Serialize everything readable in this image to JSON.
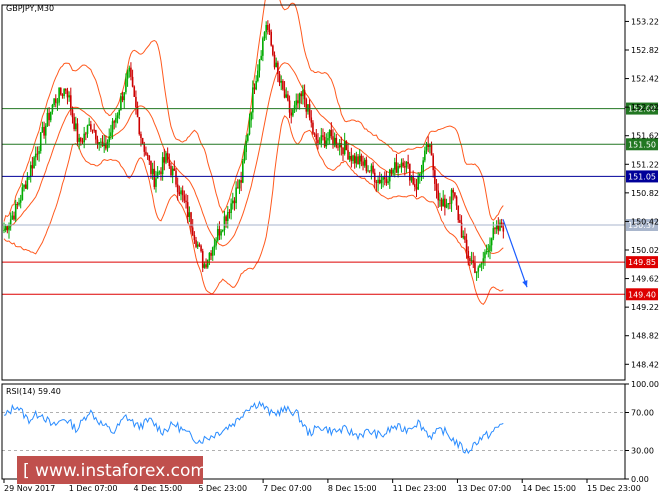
{
  "header": {
    "symbol_label": "GBPJPY,M30",
    "rsi_label": "RSI(14) 59.40"
  },
  "watermark": {
    "text": "[ www.instaforex.com ]",
    "bg_color": "#c0504d"
  },
  "colors": {
    "candle_up": "#00aa00",
    "candle_down": "#cc0000",
    "bollinger": "#ff5a1f",
    "support_resistance_green": "#227722",
    "pivot_blue": "#000099",
    "red_levels": "#dd0000",
    "current_price": "#a9b6cc",
    "arrow": "#1a5cff",
    "rsi_line": "#2a8cff"
  },
  "chart_data": [
    {
      "type": "candlestick",
      "title": "GBPJPY,M30",
      "ylim": [
        148.2,
        153.45
      ],
      "y_ticks": [
        "153.22",
        "152.82",
        "152.42",
        "152.02",
        "151.62",
        "151.22",
        "150.82",
        "150.42",
        "150.02",
        "149.62",
        "149.22",
        "148.82",
        "148.42"
      ],
      "x_tick_labels": [
        "29 Nov 2017",
        "1 Dec 07:00",
        "4 Dec 15:00",
        "5 Dec 23:00",
        "7 Dec 07:00",
        "8 Dec 15:00",
        "11 Dec 23:00",
        "13 Dec 07:00",
        "14 Dec 15:00",
        "15 Dec 23:00"
      ],
      "price_close_path": [
        150.3,
        150.6,
        151.1,
        151.6,
        152.1,
        152.3,
        151.5,
        151.8,
        151.4,
        151.9,
        152.5,
        151.6,
        151.0,
        151.3,
        150.9,
        150.4,
        149.8,
        150.2,
        150.6,
        151.0,
        152.3,
        153.2,
        152.4,
        151.9,
        152.2,
        151.5,
        151.6,
        151.5,
        151.3,
        151.2,
        151.0,
        151.1,
        151.3,
        150.9,
        151.5,
        150.6,
        150.8,
        150.0,
        149.7,
        150.2,
        150.37
      ],
      "horizontal_levels": [
        {
          "label": "152.00",
          "value": 152.0,
          "color": "#227722"
        },
        {
          "label": "151.50",
          "value": 151.5,
          "color": "#227722"
        },
        {
          "label": "151.05",
          "value": 151.05,
          "color": "#000099"
        },
        {
          "label": "150.37",
          "value": 150.37,
          "color": "#a9b6cc"
        },
        {
          "label": "149.85",
          "value": 149.85,
          "color": "#dd0000"
        },
        {
          "label": "149.40",
          "value": 149.4,
          "color": "#dd0000"
        }
      ],
      "forecast_arrow": {
        "from": 150.45,
        "to": 149.5
      }
    },
    {
      "type": "line",
      "title": "RSI(14) 59.40",
      "ylim": [
        0,
        100
      ],
      "y_ticks": [
        "100.00",
        "70.00",
        "30.00",
        "0.00"
      ],
      "levels": [
        70,
        30
      ],
      "values": [
        65,
        78,
        62,
        70,
        55,
        64,
        52,
        72,
        58,
        49,
        66,
        55,
        62,
        50,
        58,
        48,
        40,
        45,
        52,
        60,
        75,
        80,
        68,
        73,
        70,
        48,
        55,
        50,
        52,
        46,
        50,
        45,
        55,
        52,
        60,
        45,
        52,
        40,
        28,
        42,
        48,
        59.4
      ]
    }
  ]
}
